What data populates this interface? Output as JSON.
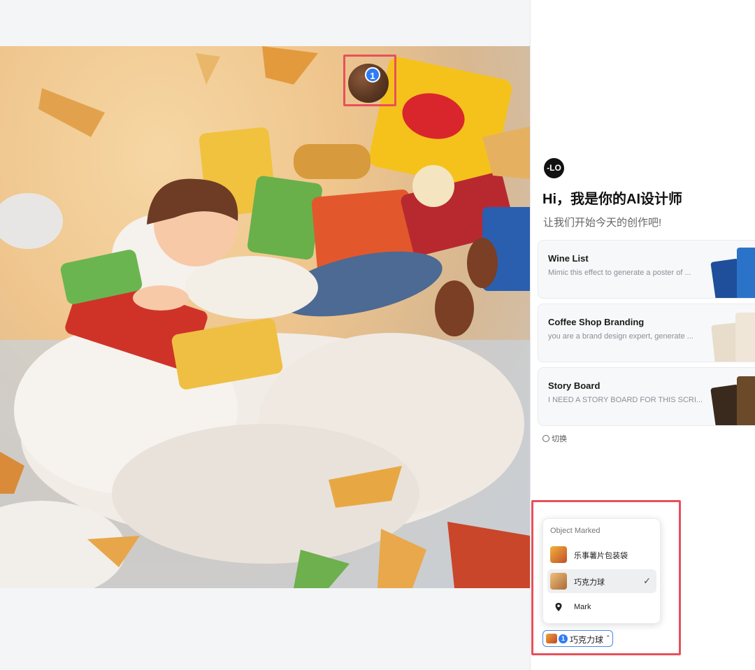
{
  "canvas": {
    "artwork_alt": "felt-style illustration: boy lying on a cloud with chips and snacks",
    "marker": {
      "number": "1"
    }
  },
  "assistant": {
    "logo_text": "-LO",
    "greeting": "Hi，我是你的AI设计师",
    "subtitle": "让我们开始今天的创作吧!",
    "cards": [
      {
        "title": "Wine List",
        "desc": "Mimic this effect to generate a poster of ..."
      },
      {
        "title": "Coffee Shop Branding",
        "desc": "you are a brand design expert, generate ..."
      },
      {
        "title": "Story Board",
        "desc": "I NEED A STORY BOARD FOR THIS SCRI..."
      }
    ],
    "switch_label": "切换"
  },
  "dropdown": {
    "header": "Object Marked",
    "items": [
      {
        "label": "乐事薯片包装袋",
        "selected": false,
        "icon": "chips-thumbnail"
      },
      {
        "label": "巧克力球",
        "selected": true,
        "icon": "chocolate-ball-thumbnail"
      },
      {
        "label": "Mark",
        "selected": false,
        "icon": "pin-icon"
      }
    ],
    "check": "✓"
  },
  "input": {
    "chip": {
      "number": "1",
      "label": "巧克力球",
      "caret": "⌃"
    }
  },
  "colors": {
    "highlight": "#e8505b",
    "pin": "#2f7cf6",
    "chip_border": "#4a86e8"
  }
}
